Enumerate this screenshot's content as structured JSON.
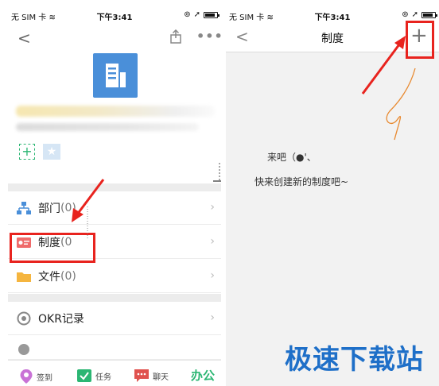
{
  "left": {
    "status": {
      "carrier": "无 SIM 卡",
      "time": "下午3:41"
    },
    "menu_items": [
      {
        "label": "部门",
        "count": "(0)"
      },
      {
        "label": "制度",
        "count": "(0"
      },
      {
        "label": "文件",
        "count": "(0)"
      },
      {
        "label": "OKR记录",
        "count": ""
      }
    ],
    "tabs": {
      "checkin": "签到",
      "task": "任务",
      "chat": "聊天",
      "office": "办公"
    }
  },
  "right": {
    "status": {
      "carrier": "无 SIM 卡",
      "time": "下午3:41"
    },
    "nav": {
      "title": "制度",
      "add": "+"
    },
    "empty_line1": "来吧（●'、",
    "empty_line2": "快来创建新的制度吧~"
  },
  "watermark": "极速下载站",
  "colors": {
    "accent_red": "#e8231e",
    "brand_green": "#2bb673",
    "logo_blue": "#4a8fd9",
    "watermark_blue": "#1e6fc8"
  }
}
